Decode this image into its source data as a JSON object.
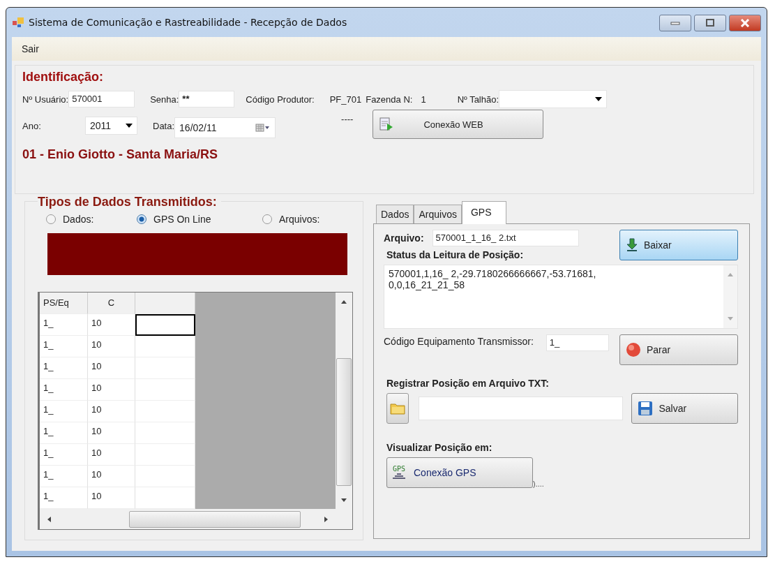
{
  "window": {
    "title": "Sistema de Comunicação e Rastreabilidade - Recepção de Dados"
  },
  "menu": [
    "Sair"
  ],
  "identificacao": {
    "title": "Identificação:",
    "usuario_label": "Nº Usuário:",
    "usuario_value": "570001",
    "senha_label": "Senha:",
    "senha_value": "**",
    "codigo_produtor_label": "Código Produtor:",
    "codigo_produtor_value": "PF_701",
    "fazenda_label": "Fazenda N:",
    "fazenda_value": "1",
    "talhao_label": "Nº Talhão:",
    "ano_label": "Ano:",
    "ano_value": "2011",
    "data_label": "Data:",
    "data_value": "16/02/11",
    "dashes": "----",
    "web_button": "Conexão WEB",
    "producer_line": "01 - Enio Giotto - Santa Maria/RS"
  },
  "tipos": {
    "title": "Tipos de Dados Transmitidos:",
    "options": [
      {
        "label": "Dados:",
        "selected": false
      },
      {
        "label": "GPS On Line",
        "selected": true
      },
      {
        "label": "Arquivos:",
        "selected": false
      }
    ],
    "table": {
      "columns": [
        "PS/Eq",
        "C"
      ],
      "rows": [
        {
          "cells": [
            "1_",
            "10"
          ],
          "selected": true
        },
        {
          "cells": [
            "1_",
            "10"
          ],
          "selected": false
        },
        {
          "cells": [
            "1_",
            "10"
          ],
          "selected": false
        },
        {
          "cells": [
            "1_",
            "10"
          ],
          "selected": false
        },
        {
          "cells": [
            "1_",
            "10"
          ],
          "selected": false
        },
        {
          "cells": [
            "1_",
            "10"
          ],
          "selected": false
        },
        {
          "cells": [
            "1_",
            "10"
          ],
          "selected": false
        },
        {
          "cells": [
            "1_",
            "10"
          ],
          "selected": false
        },
        {
          "cells": [
            "1_",
            "10"
          ],
          "selected": false
        }
      ]
    }
  },
  "tabs": [
    {
      "label": "Dados",
      "selected": false
    },
    {
      "label": "Arquivos",
      "selected": false
    },
    {
      "label": "GPS",
      "selected": true
    }
  ],
  "gps": {
    "arquivo_label": "Arquivo:",
    "arquivo_value": "570001_1_16_ 2.txt",
    "baixar_button": "Baixar",
    "status_label": "Status da Leitura de Posição:",
    "status_lines": [
      " 570001,1,16_ 2,-29.7180266666667,-53.71681,",
      "0,0,16_21_21_58"
    ],
    "codigo_label": "Código Equipamento Transmissor:",
    "codigo_value": "1_",
    "parar_button": "Parar",
    "registrar_label": "Registrar Posição em Arquivo TXT:",
    "salvar_button": "Salvar",
    "visualizar_label": "Visualizar Posição em:",
    "gps_button": "Conexão GPS",
    "gps_icon_text": "GPS",
    "trailing": ")...."
  }
}
